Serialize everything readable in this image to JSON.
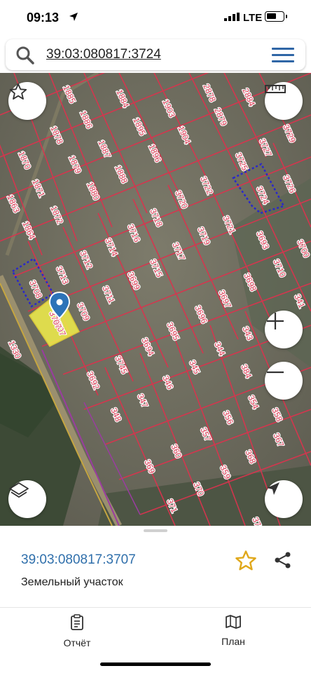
{
  "status_bar": {
    "time": "09:13",
    "network": "LTE",
    "icons": [
      "location-arrow-icon",
      "signal-icon",
      "battery-icon"
    ]
  },
  "search": {
    "query": "39:03:080817:3724"
  },
  "map": {
    "parcel_labels": [
      "1885",
      "1884",
      "1903",
      "2878",
      "2884",
      "1886",
      "1878",
      "1895",
      "2879",
      "3729",
      "1870",
      "1879",
      "1887",
      "1904",
      "3727",
      "1863",
      "1871",
      "1880",
      "1896",
      "3725",
      "3726",
      "1872",
      "1888",
      "3722",
      "3724",
      "1864",
      "3720",
      "3721",
      "3718",
      "3719",
      "3716",
      "3693",
      "3700",
      "3714",
      "3717",
      "3712",
      "3715",
      "3713",
      "3699",
      "3710",
      "3708",
      "3698",
      "3711",
      "3697",
      "341",
      "3709",
      "3696",
      "3695",
      "3707",
      "343",
      "1330",
      "3694",
      "344",
      "3745",
      "345",
      "384",
      "3692",
      "346",
      "347",
      "354",
      "348",
      "356",
      "357",
      "367",
      "358",
      "368",
      "369",
      "360",
      "359",
      "370",
      "371",
      "372",
      "361",
      "362"
    ],
    "highlighted_parcel": "3707",
    "outlined_parcels": [
      "3724",
      "3708"
    ]
  },
  "map_controls": {
    "icons": [
      "star-outline-icon",
      "ruler-icon",
      "zoom-in-icon",
      "zoom-out-icon",
      "layers-icon",
      "navigate-icon"
    ]
  },
  "parcel_card": {
    "cad_number": "39:03:080817:3707",
    "type": "Земельный участок"
  },
  "tabs": [
    {
      "label": "Отчёт",
      "icon": "report-icon"
    },
    {
      "label": "План",
      "icon": "map-plan-icon"
    }
  ],
  "colors": {
    "accent": "#2f6fab",
    "parcel_line": "#d9344e",
    "highlight": "#f2ef4a",
    "outline": "#2a28c9"
  }
}
